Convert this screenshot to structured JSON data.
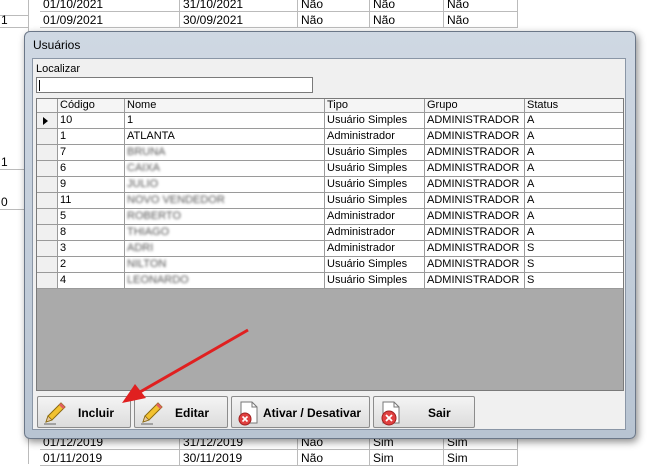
{
  "background": {
    "left_values": [
      "1",
      "1",
      "0"
    ],
    "rows": [
      {
        "start": "01/10/2021",
        "end": "31/10/2021",
        "a": "Não",
        "b": "Não",
        "c": "Não"
      },
      {
        "start": "01/09/2021",
        "end": "30/09/2021",
        "a": "Não",
        "b": "Não",
        "c": "Não"
      },
      {
        "start": "01/12/2019",
        "end": "31/12/2019",
        "a": "Não",
        "b": "Sim",
        "c": "Sim"
      },
      {
        "start": "01/11/2019",
        "end": "30/11/2019",
        "a": "Não",
        "b": "Sim",
        "c": "Sim"
      }
    ]
  },
  "dialog": {
    "title": "Usuários",
    "search": {
      "label": "Localizar",
      "value": ""
    },
    "columns": [
      "Código",
      "Nome",
      "Tipo",
      "Grupo",
      "Status"
    ],
    "users": [
      {
        "codigo": "10",
        "nome": "1",
        "tipo": "Usuário Simples",
        "grupo": "ADMINISTRADOR",
        "status": "A",
        "selected": true
      },
      {
        "codigo": "1",
        "nome": "ATLANTA",
        "tipo": "Administrador",
        "grupo": "ADMINISTRADOR",
        "status": "A"
      },
      {
        "codigo": "7",
        "nome": "BRUNA",
        "tipo": "Usuário Simples",
        "grupo": "ADMINISTRADOR",
        "status": "A",
        "blurred": true
      },
      {
        "codigo": "6",
        "nome": "CAIXA",
        "tipo": "Usuário Simples",
        "grupo": "ADMINISTRADOR",
        "status": "A",
        "blurred": true
      },
      {
        "codigo": "9",
        "nome": "JULIO",
        "tipo": "Usuário Simples",
        "grupo": "ADMINISTRADOR",
        "status": "A",
        "blurred": true
      },
      {
        "codigo": "11",
        "nome": "NOVO VENDEDOR",
        "tipo": "Usuário Simples",
        "grupo": "ADMINISTRADOR",
        "status": "A",
        "blurred": true
      },
      {
        "codigo": "5",
        "nome": "ROBERTO",
        "tipo": "Administrador",
        "grupo": "ADMINISTRADOR",
        "status": "A",
        "blurred": true
      },
      {
        "codigo": "8",
        "nome": "THIAGO",
        "tipo": "Administrador",
        "grupo": "ADMINISTRADOR",
        "status": "A",
        "blurred": true
      },
      {
        "codigo": "3",
        "nome": "ADRI",
        "tipo": "Administrador",
        "grupo": "ADMINISTRADOR",
        "status": "S",
        "blurred": true
      },
      {
        "codigo": "2",
        "nome": "NILTON",
        "tipo": "Usuário Simples",
        "grupo": "ADMINISTRADOR",
        "status": "S",
        "blurred": true
      },
      {
        "codigo": "4",
        "nome": "LEONARDO",
        "tipo": "Usuário Simples",
        "grupo": "ADMINISTRADOR",
        "status": "S",
        "blurred": true
      }
    ],
    "buttons": {
      "incluir": "Incluir",
      "editar": "Editar",
      "ativar": "Ativar / Desativar",
      "sair": "Sair"
    }
  },
  "colors": {
    "annotation_arrow": "#e02020",
    "dialog_frame": "#b8c4d2"
  },
  "icons": {
    "incluir": "pencil-icon",
    "editar": "pencil-icon",
    "ativar": "document-cancel-icon",
    "sair": "exit-icon"
  }
}
